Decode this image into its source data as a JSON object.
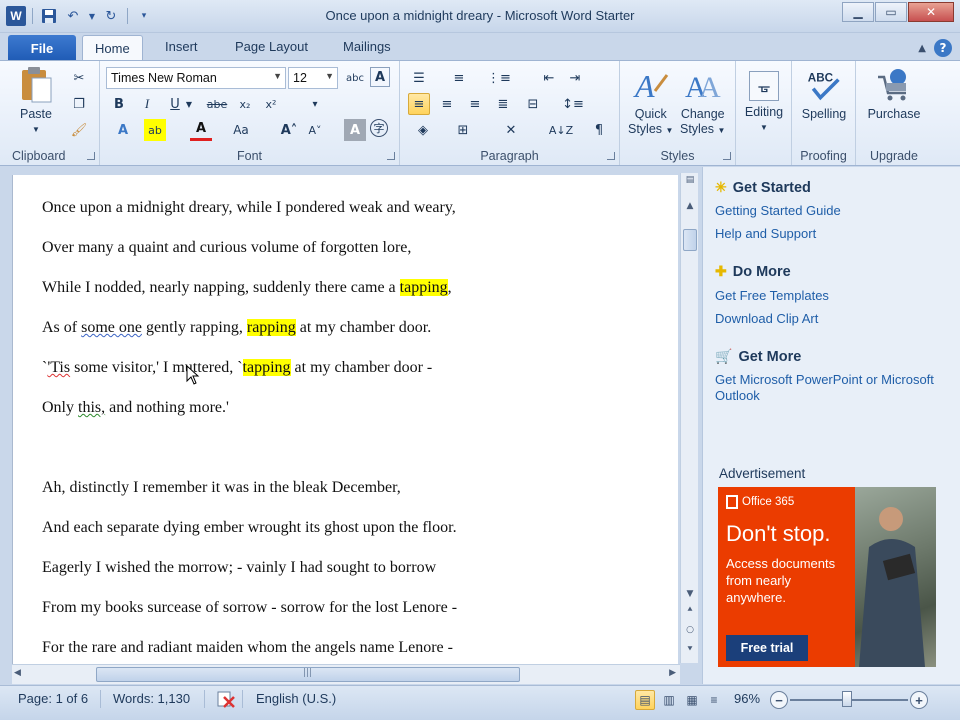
{
  "window": {
    "title": "Once upon a midnight dreary  -  Microsoft Word Starter",
    "minimize_icon": "minimize-icon",
    "maximize_icon": "maximize-icon",
    "close_icon": "close-icon"
  },
  "tabs": {
    "file": "File",
    "items": [
      "Home",
      "Insert",
      "Page Layout",
      "Mailings"
    ],
    "active": "Home"
  },
  "ribbon": {
    "clipboard": {
      "label": "Clipboard",
      "paste": "Paste"
    },
    "font": {
      "label": "Font",
      "family": "Times New Roman",
      "size": "12"
    },
    "paragraph": {
      "label": "Paragraph"
    },
    "styles": {
      "label": "Styles",
      "quick_styles_1": "Quick",
      "quick_styles_2": "Styles",
      "change_styles_1": "Change",
      "change_styles_2": "Styles"
    },
    "editing": {
      "label": "Editing"
    },
    "proofing": {
      "label": "Proofing",
      "spelling": "Spelling"
    },
    "upgrade": {
      "label": "Upgrade",
      "purchase": "Purchase"
    }
  },
  "document": {
    "lines": [
      {
        "segments": [
          {
            "text": "Once upon a midnight dreary, while I pondered weak and weary,"
          }
        ]
      },
      {
        "segments": [
          {
            "text": "Over many a quaint and curious volume of forgotten lore,"
          }
        ]
      },
      {
        "segments": [
          {
            "text": "While I nodded, nearly napping, suddenly there came a "
          },
          {
            "text": "tapping",
            "highlight": true
          },
          {
            "text": ","
          }
        ]
      },
      {
        "segments": [
          {
            "text": "As of "
          },
          {
            "text": "some one",
            "squiggle": "blue"
          },
          {
            "text": " gently rapping, "
          },
          {
            "text": "rapping",
            "highlight": true
          },
          {
            "text": " at my chamber door."
          }
        ]
      },
      {
        "segments": [
          {
            "text": "`"
          },
          {
            "text": "'Tis",
            "squiggle": "red"
          },
          {
            "text": " some visitor,' I muttered, `"
          },
          {
            "text": "tapping",
            "highlight": true
          },
          {
            "text": " at my chamber door -"
          }
        ]
      },
      {
        "segments": [
          {
            "text": "Only "
          },
          {
            "text": "this,",
            "squiggle": "green"
          },
          {
            "text": " and nothing more.'"
          }
        ]
      },
      {
        "segments": []
      },
      {
        "segments": [
          {
            "text": "Ah, distinctly I remember it was in the bleak December,"
          }
        ]
      },
      {
        "segments": [
          {
            "text": "And each separate dying ember wrought its ghost upon the floor."
          }
        ]
      },
      {
        "segments": [
          {
            "text": "Eagerly I wished the morrow; - vainly I had sought to borrow"
          }
        ]
      },
      {
        "segments": [
          {
            "text": "From my books surcease of sorrow - sorrow for the lost Lenore -"
          }
        ]
      },
      {
        "segments": [
          {
            "text": "For the rare and radiant maiden whom the angels name Lenore -"
          }
        ]
      }
    ]
  },
  "side_panel": {
    "get_started": {
      "heading": "Get Started",
      "links": [
        "Getting Started Guide",
        "Help and Support"
      ]
    },
    "do_more": {
      "heading": "Do More",
      "links": [
        "Get Free Templates",
        "Download Clip Art"
      ]
    },
    "get_more": {
      "heading": "Get More",
      "links": [
        "Get Microsoft PowerPoint or Microsoft Outlook"
      ]
    },
    "advertisement": {
      "label": "Advertisement",
      "brand": "Office 365",
      "headline": "Don't stop.",
      "body": "Access documents from nearly anywhere.",
      "button": "Free trial",
      "color": "#eb3c00"
    }
  },
  "status_bar": {
    "page": "Page: 1 of 6",
    "words": "Words: 1,130",
    "language": "English (U.S.)",
    "zoom": "96%",
    "zoom_percent": 96
  }
}
